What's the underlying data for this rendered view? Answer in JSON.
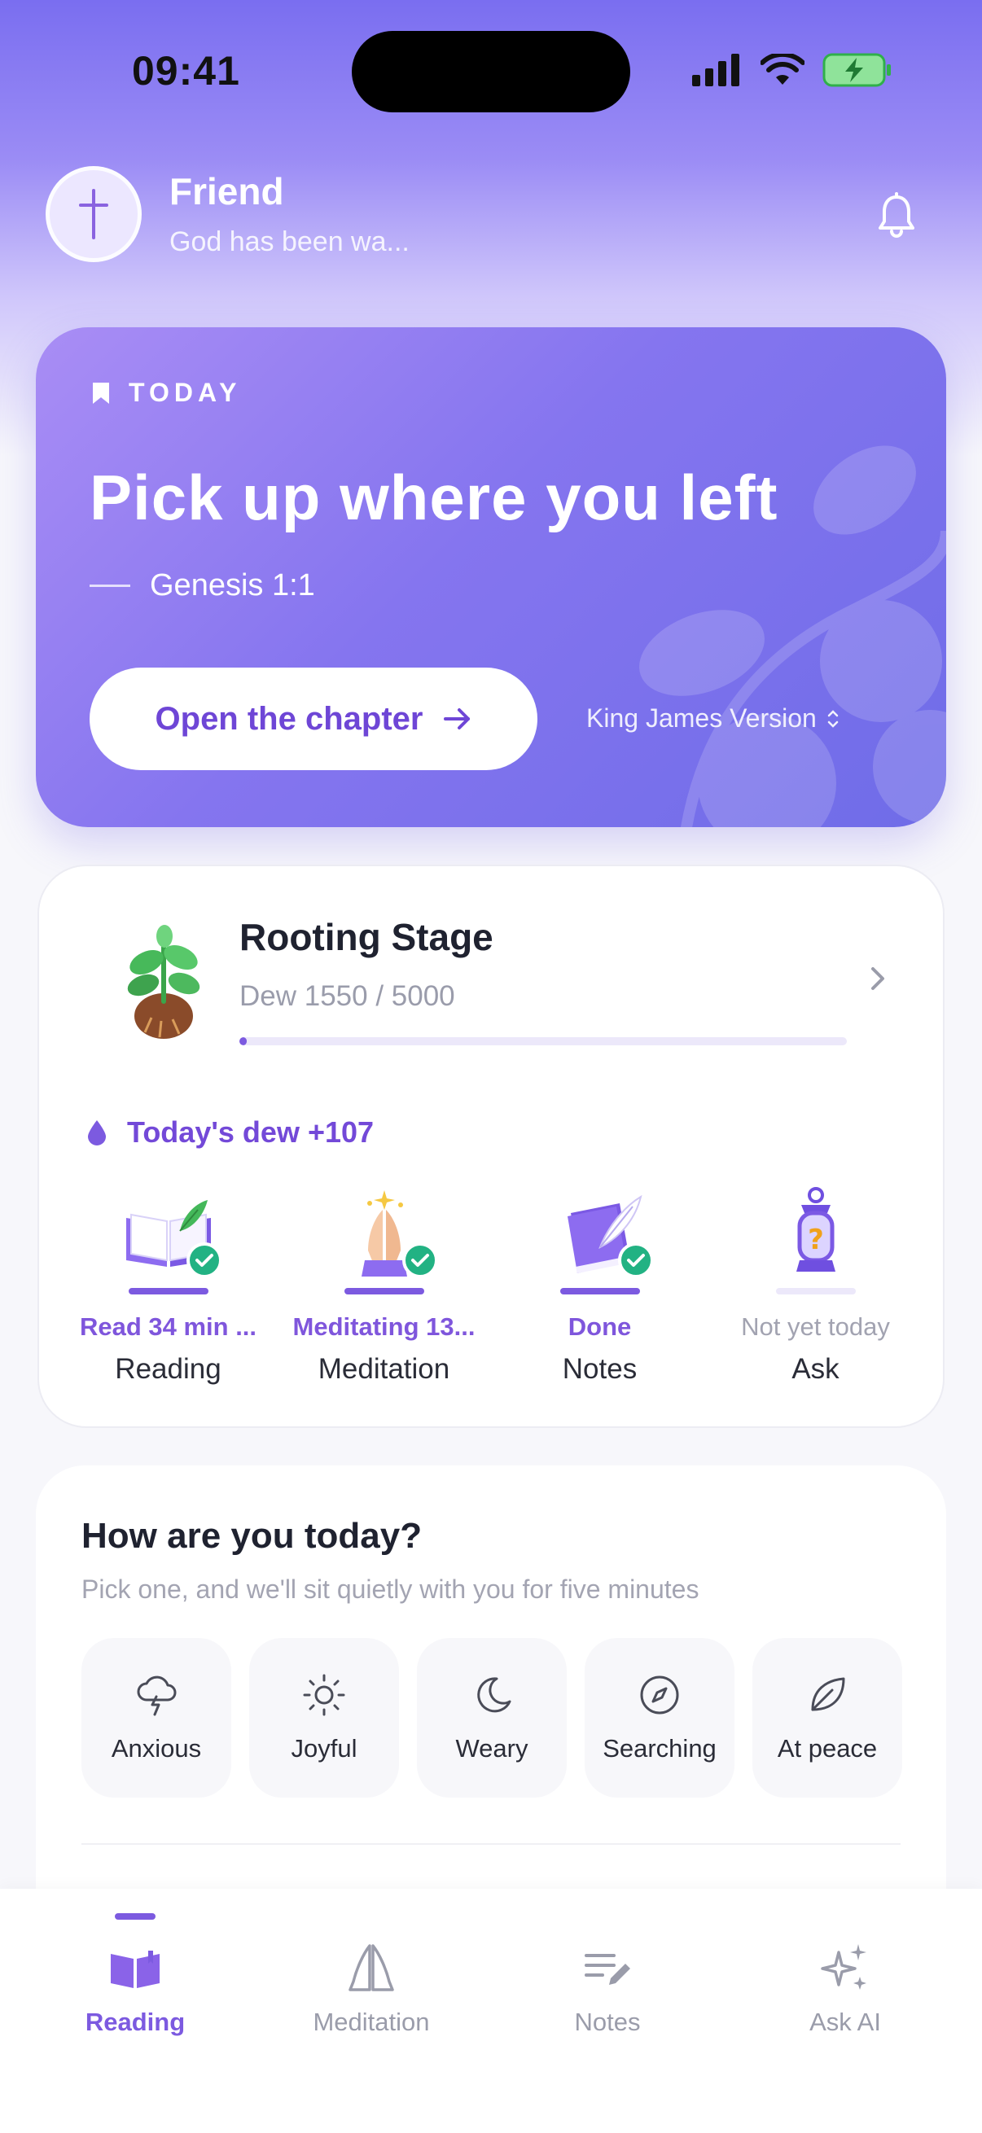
{
  "status_bar": {
    "time": "09:41"
  },
  "header": {
    "name": "Friend",
    "subtitle": "God has been wa..."
  },
  "today_card": {
    "label": "TODAY",
    "title": "Pick up where you left",
    "reference": "Genesis 1:1",
    "open_button": "Open the chapter",
    "version": "King James Version"
  },
  "progress": {
    "stage": "Rooting Stage",
    "dew_text": "Dew 1550 / 5000",
    "dew_current": 1550,
    "dew_goal": 5000,
    "today_dew": "Today's dew +107",
    "activities": [
      {
        "status": "Read 34 min ...",
        "name": "Reading",
        "done": true,
        "icon": "open-book-icon"
      },
      {
        "status": "Meditating 13...",
        "name": "Meditation",
        "done": true,
        "icon": "praying-hands-icon"
      },
      {
        "status": "Done",
        "name": "Notes",
        "done": true,
        "icon": "notebook-quill-icon"
      },
      {
        "status": "Not yet today",
        "name": "Ask",
        "done": false,
        "icon": "lantern-question-icon"
      }
    ]
  },
  "mood": {
    "title": "How are you today?",
    "subtitle": "Pick one, and we'll sit quietly with you for five minutes",
    "options": [
      {
        "label": "Anxious",
        "icon": "storm-cloud-icon"
      },
      {
        "label": "Joyful",
        "icon": "sun-icon"
      },
      {
        "label": "Weary",
        "icon": "moon-icon"
      },
      {
        "label": "Searching",
        "icon": "compass-icon"
      },
      {
        "label": "At peace",
        "icon": "leaf-icon"
      }
    ]
  },
  "tabs": [
    {
      "label": "Reading",
      "active": true,
      "icon": "book-icon"
    },
    {
      "label": "Meditation",
      "active": false,
      "icon": "praying-hands-icon"
    },
    {
      "label": "Notes",
      "active": false,
      "icon": "notes-icon"
    },
    {
      "label": "Ask AI",
      "active": false,
      "icon": "sparkles-icon"
    }
  ],
  "colors": {
    "accent": "#7c5ae0",
    "success": "#22b283",
    "card_gradient_start": "#a98df5",
    "card_gradient_end": "#6f6ce8"
  }
}
